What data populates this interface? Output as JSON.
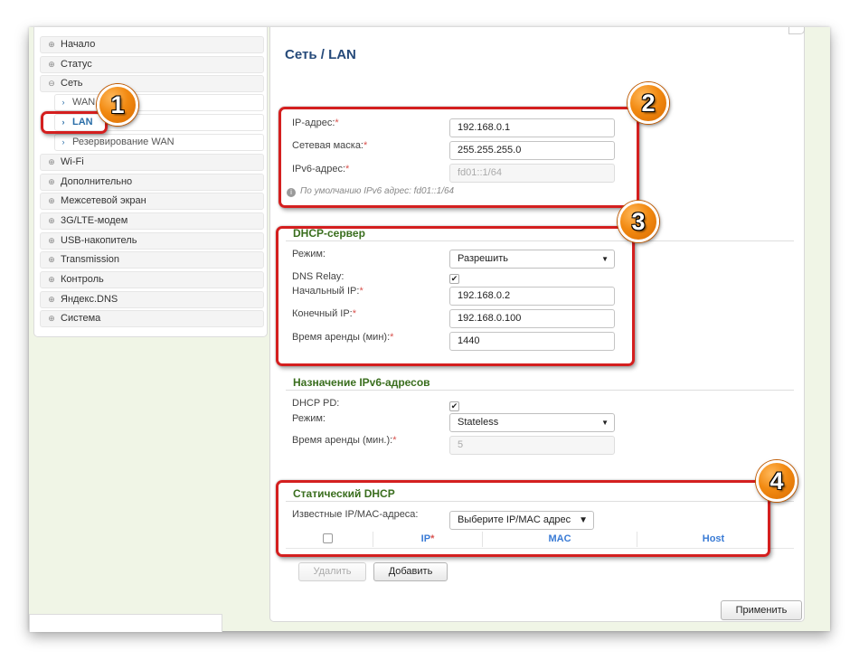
{
  "sidebar": {
    "items": [
      {
        "label": "Начало",
        "icon": "plus-circle-icon"
      },
      {
        "label": "Статус",
        "icon": "plus-circle-icon"
      },
      {
        "label": "Сеть",
        "icon": "minus-circle-icon"
      },
      {
        "label": "Wi-Fi",
        "icon": "plus-circle-icon"
      },
      {
        "label": "Дополнительно",
        "icon": "plus-circle-icon"
      },
      {
        "label": "Межсетевой экран",
        "icon": "plus-circle-icon"
      },
      {
        "label": "3G/LTE-модем",
        "icon": "plus-circle-icon"
      },
      {
        "label": "USB-накопитель",
        "icon": "plus-circle-icon"
      },
      {
        "label": "Transmission",
        "icon": "plus-circle-icon"
      },
      {
        "label": "Контроль",
        "icon": "plus-circle-icon"
      },
      {
        "label": "Яндекс.DNS",
        "icon": "plus-circle-icon"
      },
      {
        "label": "Система",
        "icon": "plus-circle-icon"
      }
    ],
    "subitems": [
      {
        "label": "WAN",
        "icon": "chevron-right-icon"
      },
      {
        "label": "LAN",
        "icon": "chevron-right-icon",
        "active": true
      },
      {
        "label": "Резервирование WAN",
        "icon": "chevron-right-icon"
      }
    ]
  },
  "page": {
    "breadcrumb_section": "Сеть",
    "breadcrumb_sep": "/",
    "breadcrumb_page": "LAN"
  },
  "ipv4": {
    "ip_label": "IP-адрес:",
    "ip_value": "192.168.0.1",
    "mask_label": "Сетевая маска:",
    "mask_value": "255.255.255.0",
    "ipv6_label": "IPv6-адрес:",
    "ipv6_placeholder": "fd01::1/64",
    "hint": "По умолчанию IPv6 адрес: fd01::1/64",
    "required_mark": "*"
  },
  "dhcp": {
    "title": "DHCP-сервер",
    "mode_label": "Режим:",
    "mode_value": "Разрешить",
    "dns_relay_label": "DNS Relay:",
    "dns_relay_checked": true,
    "start_ip_label": "Начальный IP:",
    "start_ip_value": "192.168.0.2",
    "end_ip_label": "Конечный IP:",
    "end_ip_value": "192.168.0.100",
    "lease_label": "Время аренды (мин):",
    "lease_value": "1440"
  },
  "ipv6_assign": {
    "title": "Назначение IPv6-адресов",
    "pd_label": "DHCP PD:",
    "pd_checked": true,
    "mode_label": "Режим:",
    "mode_value": "Stateless",
    "lease_label": "Время аренды (мин.):",
    "lease_value": "5"
  },
  "static_dhcp": {
    "title": "Статический DHCP",
    "known_label": "Известные IP/MAC-адреса:",
    "known_value": "Выберите IP/MAC адрес",
    "columns": [
      "IP",
      "MAC",
      "Host"
    ],
    "delete_label": "Удалить",
    "add_label": "Добавить"
  },
  "apply_label": "Применить",
  "callouts": [
    "1",
    "2",
    "3",
    "4"
  ],
  "colors": {
    "callout_border": "#d41f1f",
    "badge_orange": "#f28a12",
    "section_green": "#3a6e1e",
    "title_blue": "#264a7a",
    "header_blue": "#3a7bd5"
  }
}
